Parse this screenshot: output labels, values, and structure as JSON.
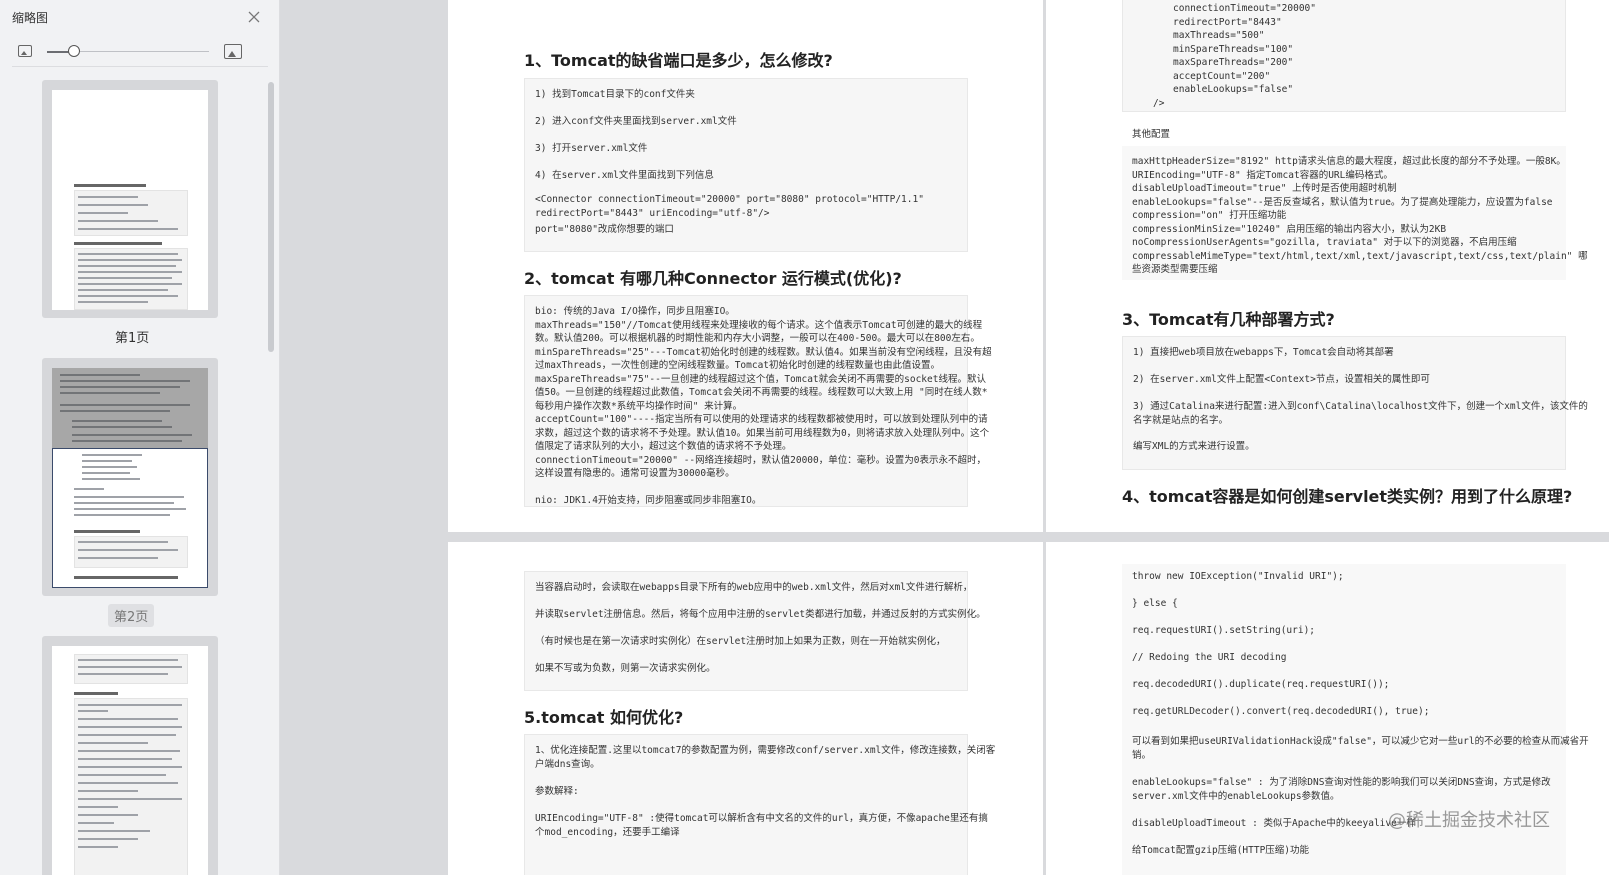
{
  "sidebar": {
    "title": "缩略图",
    "thumbnails": [
      {
        "label": "第1页"
      },
      {
        "label": "第2页"
      }
    ]
  },
  "page_tl": {
    "h1": "1、Tomcat的缺省端口是多少，怎么修改?",
    "box1": [
      "1) 找到Tomcat目录下的conf文件夹",
      "2) 进入conf文件夹里面找到server.xml文件",
      "3) 打开server.xml文件",
      "4) 在server.xml文件里面找到下列信息",
      "<Connector connectionTimeout=\"20000\" port=\"8080\" protocol=\"HTTP/1.1\"",
      "redirectPort=\"8443\" uriEncoding=\"utf-8\"/>",
      "port=\"8080\"改成你想要的端口"
    ],
    "h2": "2、tomcat 有哪几种Connector 运行模式(优化)?",
    "box2": [
      "bio: 传统的Java I/O操作，同步且阻塞IO。",
      "maxThreads=\"150\"//Tomcat使用线程来处理接收的每个请求。这个值表示Tomcat可创建的最大的线程",
      "数。默认值200。可以根据机器的时期性能和内存大小调整，一般可以在400-500。最大可以在800左右。",
      "minSpareThreads=\"25\"---Tomcat初始化时创建的线程数。默认值4。如果当前没有空闲线程，且没有超",
      "过maxThreads，一次性创建的空闲线程数量。Tomcat初始化时创建的线程数量也由此值设置。",
      "maxSpareThreads=\"75\"--一旦创建的线程超过这个值，Tomcat就会关闭不再需要的socket线程。默认",
      "值50。一旦创建的线程超过此数值，Tomcat会关闭不再需要的线程。线程数可以大致上用 \"同时在线人数*",
      "每秒用户操作次数*系统平均操作时间\" 来计算。",
      "acceptCount=\"100\"----指定当所有可以使用的处理请求的线程数都被使用时，可以放到处理队列中的请",
      "求数，超过这个数的请求将不予处理。默认值10。如果当前可用线程数为0，则将请求放入处理队列中。这个",
      "值限定了请求队列的大小，超过这个数值的请求将不予处理。",
      "connectionTimeout=\"20000\" --网络连接超时，默认值20000，单位：毫秒。设置为0表示永不超时，",
      "这样设置有隐患的。通常可设置为30000毫秒。",
      "nio: JDK1.4开始支持，同步阻塞或同步非阻塞IO。"
    ]
  },
  "page_tr": {
    "code": [
      "connectionTimeout=\"20000\"",
      "redirectPort=\"8443\"",
      "maxThreads=\"500\"",
      "minSpareThreads=\"100\"",
      "maxSpareThreads=\"200\"",
      "acceptCount=\"200\"",
      "enableLookups=\"false\"",
      "/>"
    ],
    "other_label": "其他配置",
    "other": [
      "maxHttpHeaderSize=\"8192\" http请求头信息的最大程度，超过此长度的部分不予处理。一般8K。",
      "URIEncoding=\"UTF-8\" 指定Tomcat容器的URL编码格式。",
      "disableUploadTimeout=\"true\" 上传时是否使用超时机制",
      "enableLookups=\"false\"--是否反查域名，默认值为true。为了提高处理能力，应设置为false",
      "compression=\"on\"   打开压缩功能",
      "compressionMinSize=\"10240\" 启用压缩的输出内容大小，默认为2KB",
      "noCompressionUserAgents=\"gozilla, traviata\"   对于以下的浏览器，不启用压缩",
      "compressableMimeType=\"text/html,text/xml,text/javascript,text/css,text/plain\" 哪",
      "些资源类型需要压缩"
    ],
    "h3": "3、Tomcat有几种部署方式?",
    "box3": [
      "1) 直接把web项目放在webapps下，Tomcat会自动将其部署",
      "2) 在server.xml文件上配置<Context>节点，设置相关的属性即可",
      "3) 通过Catalina来进行配置:进入到conf\\Catalina\\localhost文件下，创建一个xml文件，该文件的",
      "名字就是站点的名字。",
      "编写XML的方式来进行设置。"
    ],
    "h4": "4、tomcat容器是如何创建servlet类实例？用到了什么原理?"
  },
  "page_bl": {
    "box4": [
      "当容器启动时，会读取在webapps目录下所有的web应用中的web.xml文件，然后对xml文件进行解析，",
      "并读取servlet注册信息。然后，将每个应用中注册的servlet类都进行加载，并通过反射的方式实例化。",
      "（有时候也是在第一次请求时实例化）在servlet注册时加上如果为正数，则在一开始就实例化，",
      "如果不写或为负数，则第一次请求实例化。"
    ],
    "h5": "5.tomcat 如何优化?",
    "box5": [
      "1、优化连接配置.这里以tomcat7的参数配置为例，需要修改conf/server.xml文件，修改连接数，关闭客",
      "户端dns查询。",
      "参数解释:",
      "URIEncoding=\"UTF-8\" :使得tomcat可以解析含有中文名的文件的url，真方便，不像apache里还有搞",
      "个mod_encoding，还要手工编译"
    ]
  },
  "page_br": {
    "lines": [
      "throw new IOException(\"Invalid URI\");",
      "} else {",
      "req.requestURI().setString(uri);",
      "// Redoing the URI decoding",
      "req.decodedURI().duplicate(req.requestURI());",
      "req.getURLDecoder().convert(req.decodedURI(), true);",
      "可以看到如果把useURIValidationHack设成\"false\"，可以减少它对一些url的不必要的检查从而减省开",
      "销。",
      "enableLookups=\"false\" :  为了消除DNS查询对性能的影响我们可以关闭DNS查询，方式是修改",
      "server.xml文件中的enableLookups参数值。",
      "disableUploadTimeout : 类似于Apache中的keeyalive一样",
      "给Tomcat配置gzip压缩(HTTP压缩)功能"
    ]
  },
  "watermark": "@稀土掘金技术社区"
}
